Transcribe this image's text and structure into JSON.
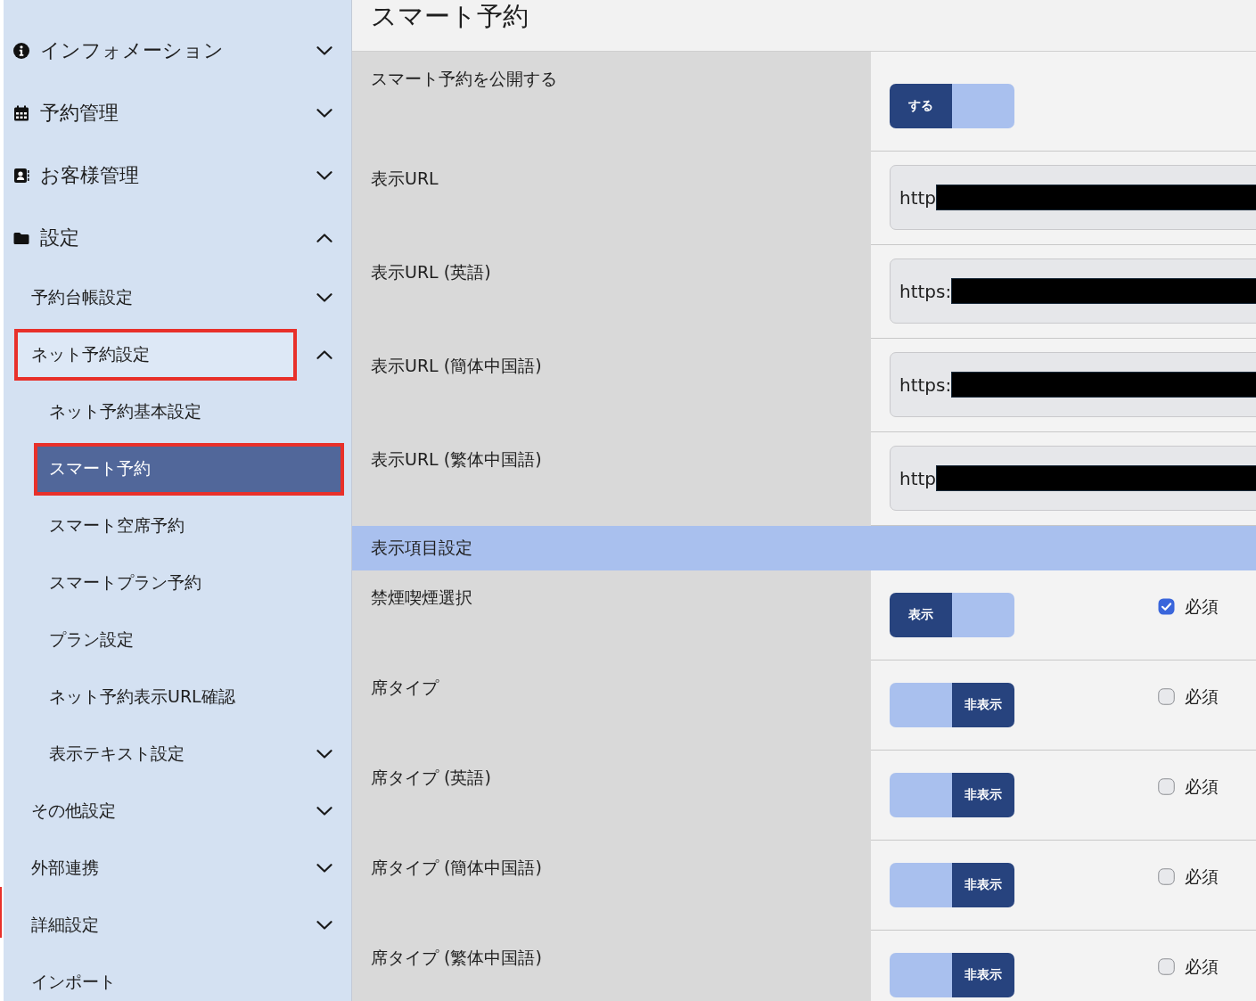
{
  "sidebar": {
    "items": [
      {
        "label": "インフォメーション",
        "expanded": false,
        "selected": false,
        "highlighted": false
      },
      {
        "label": "予約管理",
        "expanded": false,
        "selected": false,
        "highlighted": false
      },
      {
        "label": "お客様管理",
        "expanded": false,
        "selected": false,
        "highlighted": false
      },
      {
        "label": "設定",
        "expanded": true,
        "selected": false,
        "highlighted": false,
        "children": [
          {
            "label": "予約台帳設定",
            "expanded": false,
            "selected": false,
            "highlighted": false
          },
          {
            "label": "ネット予約設定",
            "expanded": true,
            "selected": false,
            "highlighted": true,
            "children": [
              {
                "label": "ネット予約基本設定",
                "selected": false,
                "highlighted": false
              },
              {
                "label": "スマート予約",
                "selected": true,
                "highlighted": true
              },
              {
                "label": "スマート空席予約",
                "selected": false,
                "highlighted": false
              },
              {
                "label": "スマートプラン予約",
                "selected": false,
                "highlighted": false
              },
              {
                "label": "プラン設定",
                "selected": false,
                "highlighted": false
              },
              {
                "label": "ネット予約表示URL確認",
                "selected": false,
                "highlighted": false
              },
              {
                "label": "表示テキスト設定",
                "expanded": false,
                "selected": false,
                "highlighted": false
              }
            ]
          },
          {
            "label": "その他設定",
            "expanded": false,
            "selected": false,
            "highlighted": false
          },
          {
            "label": "外部連携",
            "expanded": false,
            "selected": false,
            "highlighted": false
          },
          {
            "label": "詳細設定",
            "expanded": false,
            "selected": false,
            "highlighted": false
          },
          {
            "label": "インポート",
            "selected": false,
            "highlighted": false
          }
        ]
      }
    ]
  },
  "page_title": "スマート予約",
  "settings": [
    {
      "kind": "toggle",
      "label": "スマート予約を公開する",
      "toggle": {
        "text": "する",
        "on": true
      }
    },
    {
      "kind": "url",
      "label": "表示URL",
      "value": "http",
      "redacted": true
    },
    {
      "kind": "url",
      "label": "表示URL (英語)",
      "value": "https:",
      "redacted": true
    },
    {
      "kind": "url",
      "label": "表示URL (簡体中国語)",
      "value": "https:",
      "redacted": true
    },
    {
      "kind": "url",
      "label": "表示URL (繁体中国語)",
      "value": "http",
      "redacted": true
    }
  ],
  "display_items": {
    "title": "表示項目設定",
    "items": [
      {
        "label": "禁煙喫煙選択",
        "toggle": {
          "text": "表示",
          "on": true
        },
        "required": {
          "label": "必須",
          "checked": true
        }
      },
      {
        "label": "席タイプ",
        "toggle": {
          "text": "非表示",
          "on": false
        },
        "required": {
          "label": "必須",
          "checked": false
        }
      },
      {
        "label": "席タイプ (英語)",
        "toggle": {
          "text": "非表示",
          "on": false
        },
        "required": {
          "label": "必須",
          "checked": false
        }
      },
      {
        "label": "席タイプ (簡体中国語)",
        "toggle": {
          "text": "非表示",
          "on": false
        },
        "required": {
          "label": "必須",
          "checked": false
        }
      },
      {
        "label": "席タイプ (繁体中国語)",
        "toggle": {
          "text": "非表示",
          "on": false
        },
        "required": {
          "label": "必須",
          "checked": false
        }
      }
    ]
  }
}
